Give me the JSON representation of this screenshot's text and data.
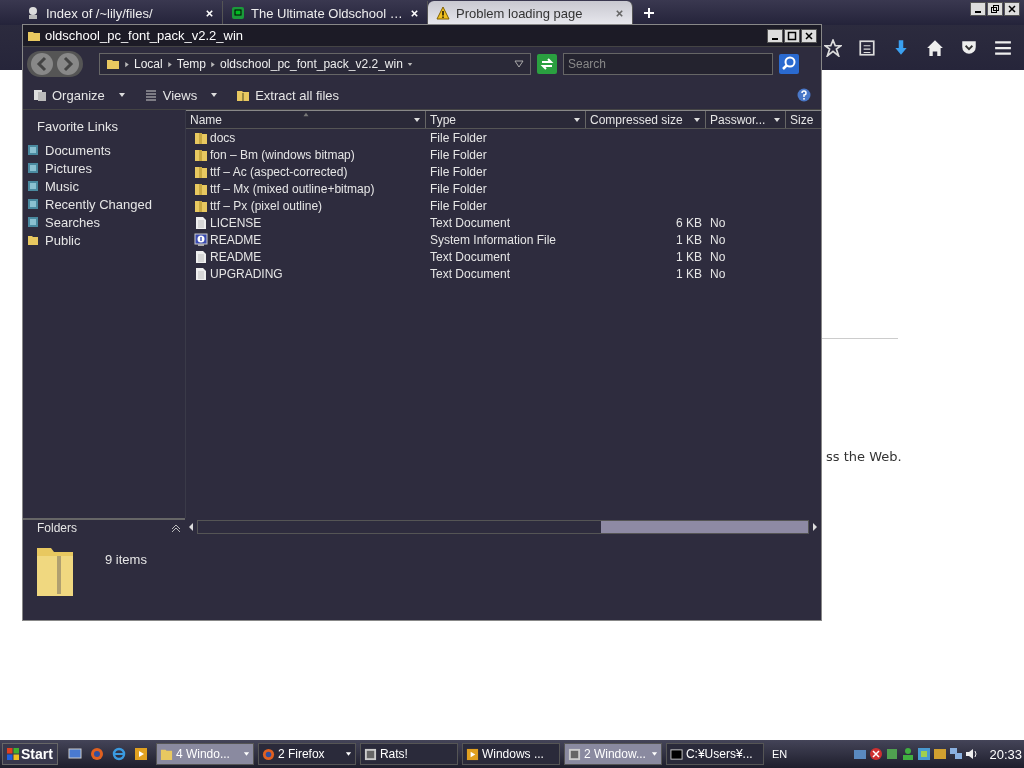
{
  "browser": {
    "tabs": [
      {
        "label": "Index of /~lily/files/",
        "selected": false,
        "kind": "page"
      },
      {
        "label": "The Ultimate Oldschool …",
        "selected": false,
        "kind": "app"
      },
      {
        "label": "Problem loading page",
        "selected": true,
        "kind": "warning"
      }
    ],
    "page_text": "ss the Web."
  },
  "explorer": {
    "title": "oldschool_pc_font_pack_v2.2_win",
    "breadcrumb": [
      "Local",
      "Temp",
      "oldschool_pc_font_pack_v2.2_win"
    ],
    "search": {
      "placeholder": "Search"
    },
    "commands": [
      {
        "label": "Organize",
        "dropdown": true
      },
      {
        "label": "Views",
        "dropdown": true
      },
      {
        "label": "Extract all files",
        "dropdown": false
      }
    ],
    "favorites_title": "Favorite Links",
    "favorites": [
      {
        "label": "Documents",
        "kind": "library"
      },
      {
        "label": "Pictures",
        "kind": "library"
      },
      {
        "label": "Music",
        "kind": "library"
      },
      {
        "label": "Recently Changed",
        "kind": "library"
      },
      {
        "label": "Searches",
        "kind": "library"
      },
      {
        "label": "Public",
        "kind": "folder"
      }
    ],
    "folders_title": "Folders",
    "columns": [
      {
        "label": "Name",
        "sorted": true,
        "filter": true
      },
      {
        "label": "Type",
        "sorted": false,
        "filter": true
      },
      {
        "label": "Compressed size",
        "sorted": false,
        "filter": true
      },
      {
        "label": "Passwor...",
        "sorted": false,
        "filter": true
      },
      {
        "label": "Size",
        "sorted": false,
        "filter": false
      }
    ],
    "rows": [
      {
        "name": "docs",
        "kind": "folder",
        "type": "File Folder"
      },
      {
        "name": "fon – Bm (windows bitmap)",
        "kind": "folder",
        "type": "File Folder"
      },
      {
        "name": "ttf – Ac (aspect-corrected)",
        "kind": "folder",
        "type": "File Folder"
      },
      {
        "name": "ttf – Mx (mixed outline+bitmap)",
        "kind": "folder",
        "type": "File Folder"
      },
      {
        "name": "ttf – Px (pixel outline)",
        "kind": "folder",
        "type": "File Folder"
      },
      {
        "name": "LICENSE",
        "kind": "text",
        "type": "Text Document",
        "compressed_size": "6 KB",
        "password": "No"
      },
      {
        "name": "README",
        "kind": "info",
        "type": "System Information File",
        "compressed_size": "1 KB",
        "password": "No"
      },
      {
        "name": "README",
        "kind": "text",
        "type": "Text Document",
        "compressed_size": "1 KB",
        "password": "No"
      },
      {
        "name": "UPGRADING",
        "kind": "text",
        "type": "Text Document",
        "compressed_size": "1 KB",
        "password": "No"
      }
    ],
    "status": "9 items"
  },
  "taskbar": {
    "start": "Start",
    "tasks": [
      {
        "label": "4 Windo...",
        "selected": true,
        "menu": true,
        "kind": "folder"
      },
      {
        "label": "2 Firefox",
        "selected": false,
        "menu": true,
        "kind": "browser"
      },
      {
        "label": "Rats!",
        "selected": false,
        "menu": false,
        "kind": "app"
      },
      {
        "label": "Windows ...",
        "selected": false,
        "menu": false,
        "kind": "media"
      },
      {
        "label": "2 Window...",
        "selected": true,
        "menu": true,
        "kind": "app"
      },
      {
        "label": "C:¥Users¥...",
        "selected": false,
        "menu": false,
        "kind": "console"
      }
    ],
    "language": "EN",
    "clock": "20:33"
  }
}
